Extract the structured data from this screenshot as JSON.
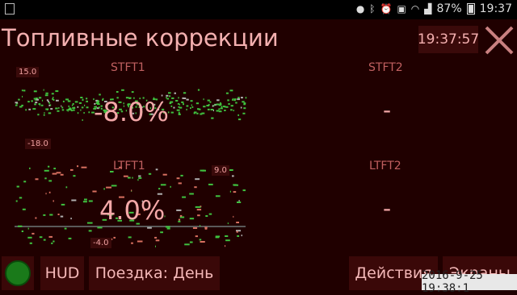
{
  "statusbar": {
    "battery_percent": "87%",
    "time": "19:37",
    "icons": [
      "location-icon",
      "bluetooth-icon",
      "alarm-icon",
      "badge-icon",
      "wifi-icon",
      "signal-icon",
      "battery-icon"
    ]
  },
  "header": {
    "title": "Топливные коррекции",
    "clock": "19:37:57"
  },
  "gauges": {
    "stft1": {
      "label": "STFT1",
      "value": "-8.0%",
      "tag_max": "15.0",
      "tag_min": "-18.0"
    },
    "stft2": {
      "label": "STFT2",
      "value": "-"
    },
    "ltft1": {
      "label": "LTFT1",
      "value": "4.0%",
      "tag_max": "9.0",
      "tag_min": "-4.0"
    },
    "ltft2": {
      "label": "LTFT2",
      "value": "-"
    }
  },
  "bottombar": {
    "hud_label": "HUD",
    "trip_label": "Поездка: День",
    "actions_label": "Действия",
    "screens_label": "Экраны"
  },
  "stamp": "2016-9-25 19:38:1",
  "colors": {
    "background": "#200000",
    "accent_text": "#f4b0b0",
    "trace": "#3fc23f",
    "button_bg": "#3a0808"
  }
}
